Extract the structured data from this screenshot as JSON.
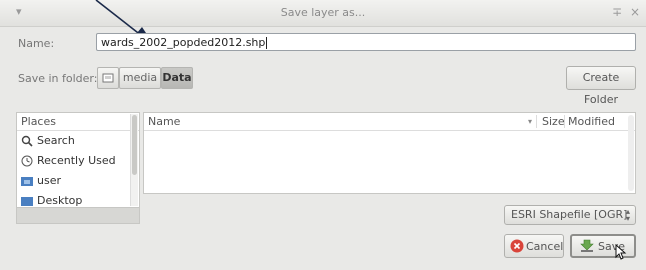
{
  "window": {
    "title": "Save layer as...",
    "menu_glyph": "▾",
    "pin_glyph": "∓",
    "close_glyph": "×"
  },
  "name_field": {
    "label": "Name:",
    "value": "wards_2002_popded2012.shp"
  },
  "save_in": {
    "label": "Save in folder:",
    "path": [
      "media",
      "Data"
    ],
    "active_index": 1,
    "create_folder_label": "Create Folder"
  },
  "places": {
    "header": "Places",
    "items": [
      {
        "label": "Search",
        "icon": "search-icon"
      },
      {
        "label": "Recently Used",
        "icon": "recent-clock-icon"
      },
      {
        "label": "user",
        "icon": "home-folder-icon"
      },
      {
        "label": "Desktop",
        "icon": "desktop-icon"
      }
    ]
  },
  "files": {
    "columns": {
      "name": "Name",
      "size": "Size",
      "modified": "Modified"
    },
    "sort_glyph": "▾",
    "rows": []
  },
  "filter": {
    "selected": "ESRI Shapefile [OGR]",
    "up": "▴",
    "down": "▾"
  },
  "buttons": {
    "cancel": "Cancel",
    "save": "Save"
  },
  "colors": {
    "cancel_icon": "#d9443a",
    "save_icon": "#6aa84f",
    "folder_icon": "#4a7fc1"
  }
}
